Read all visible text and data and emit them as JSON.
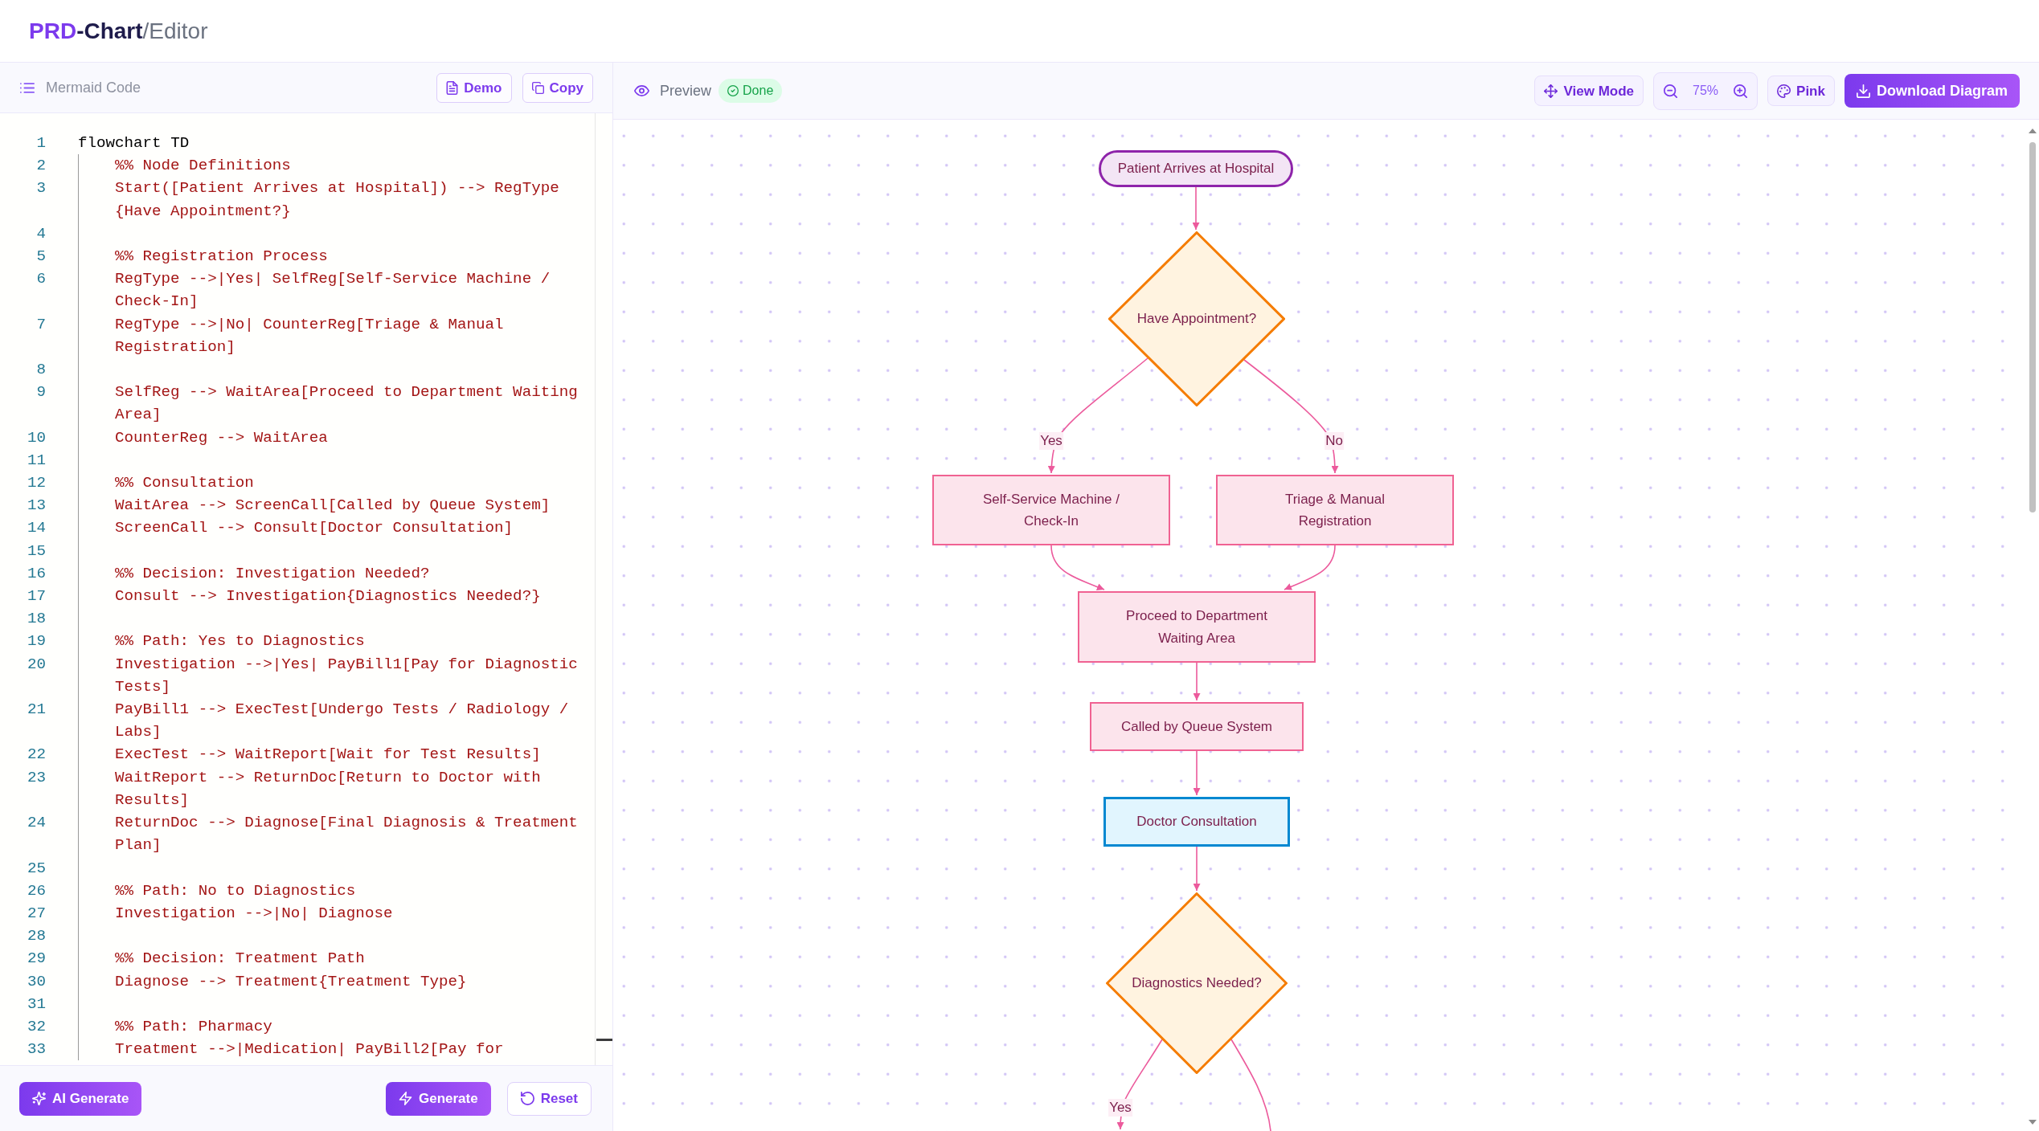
{
  "header": {
    "brand": "PRD",
    "product": "-Chart",
    "page": "/Editor"
  },
  "editor": {
    "title": "Mermaid Code",
    "buttons": [
      {
        "kind": "demo",
        "label": "Demo"
      },
      {
        "kind": "copy",
        "label": "Copy"
      }
    ],
    "lines": [
      {
        "number": "1",
        "text": "flowchart TD",
        "children": [
          {
            "number": "2",
            "text": "%% Node Definitions"
          },
          {
            "number": "3",
            "text": "Start([Patient Arrives at Hospital]) --> RegType {Have Appointment?}"
          },
          {
            "number": "4"
          },
          {
            "number": "5",
            "text": "%% Registration Process"
          },
          {
            "number": "6",
            "text": "RegType -->|Yes| SelfReg[Self-Service Machine / Check-In]"
          },
          {
            "number": "7",
            "text": "RegType -->|No| CounterReg[Triage & Manual Registration]"
          },
          {
            "number": "8"
          },
          {
            "number": "9",
            "text": "SelfReg --> WaitArea[Proceed to Department Waiting Area]"
          },
          {
            "number": "10",
            "text": "CounterReg --> WaitArea"
          },
          {
            "number": "11"
          },
          {
            "number": "12",
            "text": "%% Consultation"
          },
          {
            "number": "13",
            "text": "WaitArea --> ScreenCall[Called by Queue System]"
          },
          {
            "number": "14",
            "text": "ScreenCall --> Consult[Doctor Consultation]"
          },
          {
            "number": "15"
          },
          {
            "number": "16",
            "text": "%% Decision: Investigation Needed?"
          },
          {
            "number": "17",
            "text": "Consult --> Investigation{Diagnostics Needed?}"
          },
          {
            "number": "18"
          },
          {
            "number": "19",
            "text": "%% Path: Yes to Diagnostics"
          },
          {
            "number": "20",
            "text": "Investigation -->|Yes| PayBill1[Pay for Diagnostic Tests]"
          },
          {
            "number": "21",
            "text": "PayBill1 --> ExecTest[Undergo Tests / Radiology / Labs]"
          },
          {
            "number": "22",
            "text": "ExecTest --> WaitReport[Wait for Test Results]"
          },
          {
            "number": "23",
            "text": "WaitReport --> ReturnDoc[Return to Doctor with Results]"
          },
          {
            "number": "24",
            "text": "ReturnDoc --> Diagnose[Final Diagnosis & Treatment Plan]"
          },
          {
            "number": "25"
          },
          {
            "number": "26",
            "text": "%% Path: No to Diagnostics"
          },
          {
            "number": "27",
            "text": "Investigation -->|No| Diagnose"
          },
          {
            "number": "28"
          },
          {
            "number": "29",
            "text": "%% Decision: Treatment Path"
          },
          {
            "number": "30",
            "text": "Diagnose --> Treatment{Treatment Type}"
          },
          {
            "number": "31"
          },
          {
            "number": "32",
            "text": "%% Path: Pharmacy"
          },
          {
            "number": "33",
            "text": "Treatment -->|Medication| PayBill2[Pay for"
          }
        ]
      }
    ],
    "actions": [
      {
        "kind": "ai",
        "label": "AI Generate"
      },
      {
        "kind": "generate",
        "label": "Generate"
      },
      {
        "kind": "reset",
        "label": "Reset"
      }
    ]
  },
  "preview": {
    "title": "Preview",
    "status": {
      "kind": "success",
      "label": "Done"
    },
    "tools": [
      {
        "kind": "view",
        "label": "View Mode"
      },
      {
        "kind": "zoom",
        "label": "75%"
      },
      {
        "kind": "theme",
        "label": "Pink"
      },
      {
        "kind": "download",
        "label": "Download Diagram"
      }
    ]
  },
  "diagram": {
    "nodes": [
      {
        "kind": "terminal",
        "label": "Patient Arrives at Hospital"
      },
      {
        "kind": "decision",
        "label": "Have Appointment?"
      },
      {
        "kind": "process",
        "label": "Self-Service Machine / Check-In"
      },
      {
        "kind": "process",
        "label": "Triage & Manual Registration"
      },
      {
        "kind": "process",
        "label": "Proceed to Department Waiting Area"
      },
      {
        "kind": "process",
        "label": "Called by Queue System"
      },
      {
        "kind": "emphasis",
        "label": "Doctor Consultation"
      },
      {
        "kind": "decision",
        "label": "Diagnostics Needed?"
      }
    ],
    "edge_labels": [
      "Yes",
      "No",
      "Yes"
    ]
  }
}
